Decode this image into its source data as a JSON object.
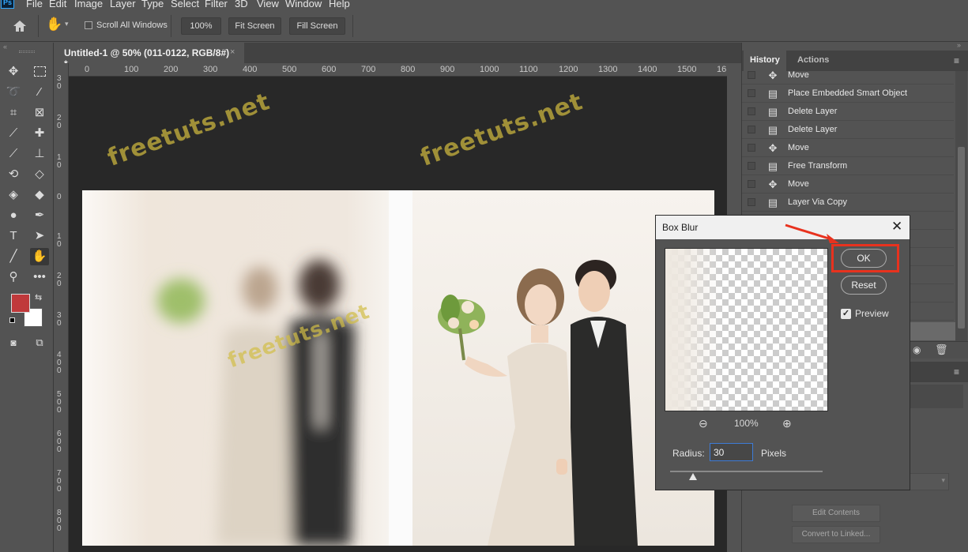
{
  "menu": {
    "items": [
      "File",
      "Edit",
      "Image",
      "Layer",
      "Type",
      "Select",
      "Filter",
      "3D",
      "View",
      "Window",
      "Help"
    ]
  },
  "options_bar": {
    "scroll_all_windows_label": "Scroll All Windows",
    "zoom_button": "100%",
    "fit_screen_button": "Fit Screen",
    "fill_screen_button": "Fill Screen"
  },
  "document": {
    "tab_title": "Untitled-1 @ 50% (011-0122, RGB/8#) *",
    "ruler_h_labels": [
      "0",
      "100",
      "200",
      "300",
      "400",
      "500",
      "600",
      "700",
      "800",
      "900",
      "1000",
      "1100",
      "1200",
      "1300",
      "1400",
      "1500",
      "16"
    ],
    "ruler_v_labels": [
      "3\n0",
      "2\n0",
      "1\n0",
      "0",
      "1\n0",
      "2\n0",
      "3\n0",
      "4\n0\n0",
      "5\n0\n0",
      "6\n0\n0",
      "7\n0\n0",
      "8\n0\n0"
    ],
    "watermark_text": "freetuts.net"
  },
  "history_panel": {
    "tabs": [
      "History",
      "Actions"
    ],
    "items": [
      {
        "label": "Move",
        "icon": "move-icon"
      },
      {
        "label": "Place Embedded Smart Object",
        "icon": "document-icon"
      },
      {
        "label": "Delete Layer",
        "icon": "document-icon"
      },
      {
        "label": "Delete Layer",
        "icon": "document-icon"
      },
      {
        "label": "Move",
        "icon": "move-icon"
      },
      {
        "label": "Free Transform",
        "icon": "document-icon"
      },
      {
        "label": "Move",
        "icon": "move-icon"
      },
      {
        "label": "Layer Via Copy",
        "icon": "document-icon"
      }
    ]
  },
  "properties_panel": {
    "edit_contents_button": "Edit Contents",
    "convert_to_linked_button": "Convert to Linked..."
  },
  "box_blur_dialog": {
    "title": "Box Blur",
    "ok_button": "OK",
    "reset_button": "Reset",
    "preview_label": "Preview",
    "preview_checked": true,
    "zoom_level": "100%",
    "radius_label": "Radius:",
    "radius_value": "30",
    "radius_unit": "Pixels",
    "radius_slider_fraction": 0.15
  },
  "colors": {
    "foreground": "#c0393b",
    "background": "#ffffff",
    "highlight": "#e8321e"
  }
}
